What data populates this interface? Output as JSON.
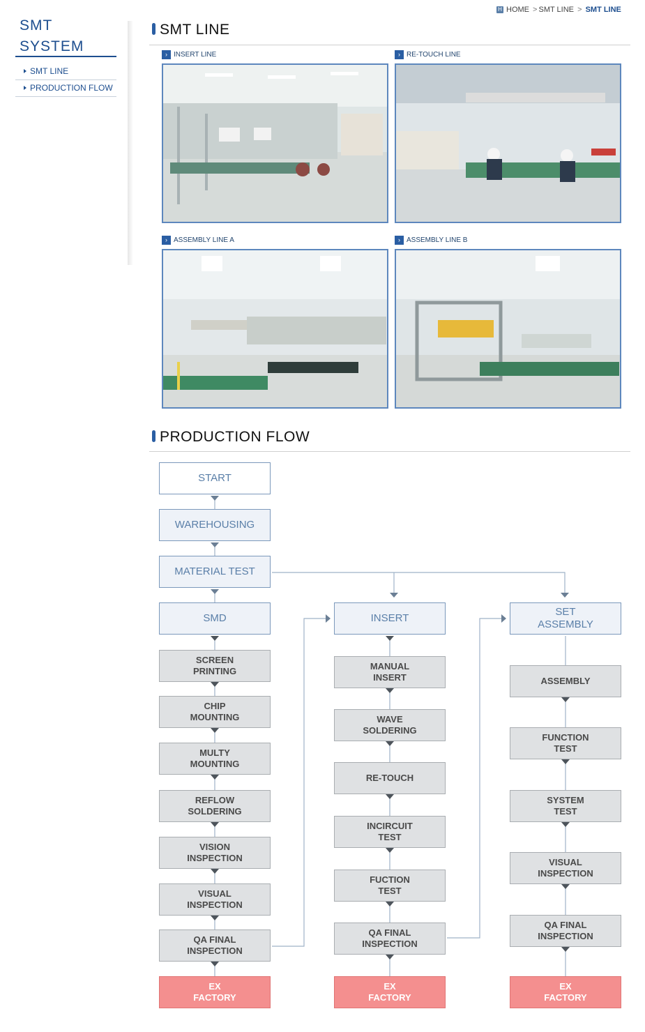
{
  "sidebar": {
    "title_line1": "SMT",
    "title_line2": "SYSTEM",
    "items": [
      {
        "label": "SMT LINE"
      },
      {
        "label": "PRODUCTION FLOW"
      }
    ]
  },
  "breadcrumb": {
    "home": "HOME",
    "level1": "SMT LINE",
    "current": "SMT LINE"
  },
  "smt_line": {
    "heading": "SMT LINE",
    "photos": [
      {
        "label": "INSERT LINE"
      },
      {
        "label": "RE-TOUCH LINE"
      },
      {
        "label": "ASSEMBLY LINE A"
      },
      {
        "label": "ASSEMBLY LINE B"
      }
    ]
  },
  "production_flow": {
    "heading": "PRODUCTION FLOW",
    "start": "START",
    "warehousing": "WAREHOUSING",
    "material_test": "MATERIAL TEST",
    "smd": {
      "title": "SMD",
      "steps": [
        "SCREEN\nPRINTING",
        "CHIP\nMOUNTING",
        "MULTY\nMOUNTING",
        "REFLOW\nSOLDERING",
        "VISION\nINSPECTION",
        "VISUAL\nINSPECTION",
        "QA FINAL\nINSPECTION"
      ],
      "exit": "EX\nFACTORY"
    },
    "insert": {
      "title": "INSERT",
      "steps": [
        "MANUAL\nINSERT",
        "WAVE\nSOLDERING",
        "RE-TOUCH",
        "INCIRCUIT\nTEST",
        "FUCTION\nTEST",
        "QA FINAL\nINSPECTION"
      ],
      "exit": "EX\nFACTORY"
    },
    "set_assembly": {
      "title": "SET\nASSEMBLY",
      "steps": [
        "ASSEMBLY",
        "FUNCTION\nTEST",
        "SYSTEM\nTEST",
        "VISUAL\nINSPECTION",
        "QA FINAL\nINSPECTION"
      ],
      "exit": "EX\nFACTORY"
    }
  },
  "colors": {
    "brand_blue": "#1d4e8f",
    "flow_main_fill": "#eef2f8",
    "flow_step_fill": "#dfe1e3",
    "exit_red": "#f48f8f"
  }
}
